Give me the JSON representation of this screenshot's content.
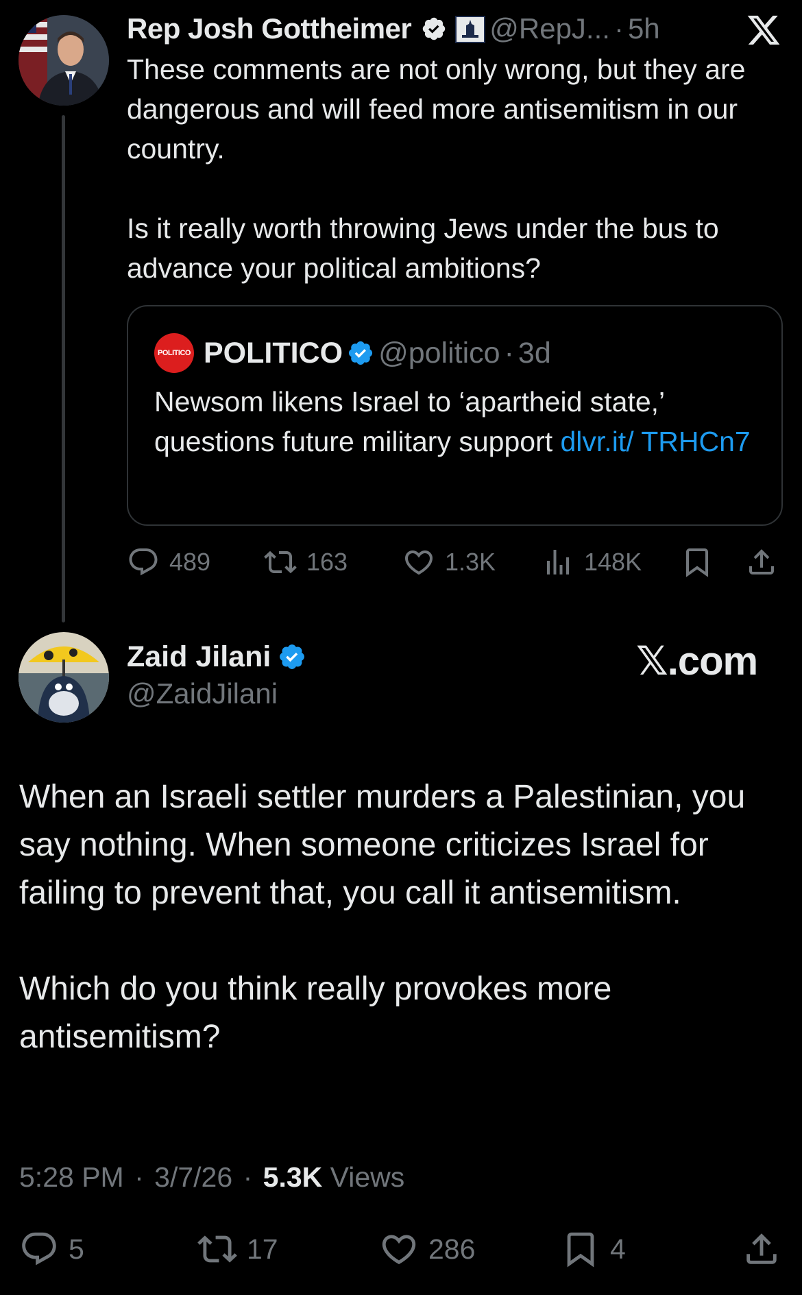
{
  "tweet1": {
    "author_name": "Rep Josh Gottheimer",
    "handle": "@RepJ...",
    "sep": "·",
    "time": "5h",
    "paragraphs": [
      "These comments are not only wrong, but they are dangerous and will feed more antisemitism in our country.",
      "Is it really worth throwing Jews under the bus to advance your political ambitions?"
    ],
    "quote": {
      "logo_text": "POLITICO",
      "name": "POLITICO",
      "handle": "@politico",
      "sep": "·",
      "time": "3d",
      "text": "Newsom likens Israel to ‘apartheid state,’ questions future military support ",
      "link": "dlvr.it/ TRHCn7"
    },
    "stats": {
      "replies": "489",
      "reposts": "163",
      "likes": "1.3K",
      "views": "148K"
    }
  },
  "tweet2": {
    "author_name": "Zaid Jilani",
    "handle": "@ZaidJilani",
    "paragraphs": [
      "When an Israeli settler murders a Palestinian, you say nothing. When someone criticizes Israel for failing to prevent that, you call it antisemitism.",
      "Which do you think really provokes more antisemitism?"
    ],
    "time": "5:28 PM",
    "sep1": "·",
    "date": "3/7/26",
    "sep2": "·",
    "views_count": "5.3K",
    "views_label": "Views",
    "stats": {
      "replies": "5",
      "reposts": "17",
      "likes": "286",
      "bookmarks": "4"
    }
  },
  "watermark": "𝕏.com",
  "colors": {
    "background": "#000000",
    "text": "#e7e9ea",
    "muted": "#71767b",
    "link": "#1d9bf0",
    "verified": "#1d9bf0",
    "politico_red": "#dc1e1e"
  },
  "icons": [
    "x-logo-icon",
    "verified-icon",
    "capitol-badge-icon",
    "reply-icon",
    "repost-icon",
    "like-icon",
    "views-icon",
    "bookmark-icon",
    "share-icon"
  ]
}
